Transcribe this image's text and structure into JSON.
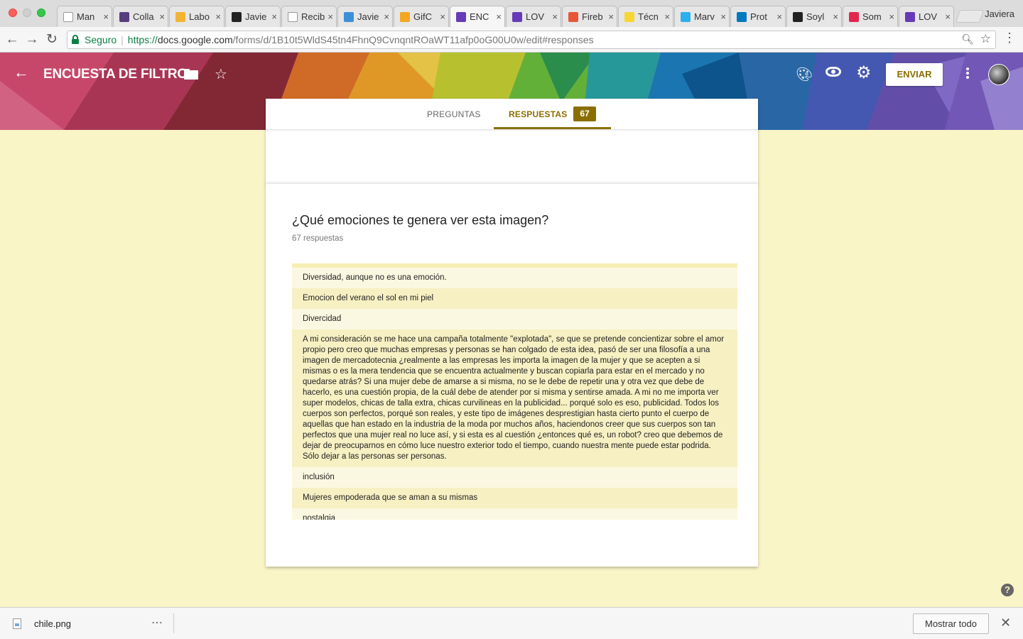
{
  "browser": {
    "tabs": [
      {
        "title": "Man",
        "icon": "document-icon",
        "color": "#ffffff"
      },
      {
        "title": "Colla",
        "icon": "bootstrap-icon",
        "color": "#563d7c"
      },
      {
        "title": "Labo",
        "icon": "code-icon",
        "color": "#f1b434"
      },
      {
        "title": "Javie",
        "icon": "github-icon",
        "color": "#222222"
      },
      {
        "title": "Recib",
        "icon": "gmail-icon",
        "color": "#ffffff"
      },
      {
        "title": "Javie",
        "icon": "filter-icon",
        "color": "#3d8fd8"
      },
      {
        "title": "GifC",
        "icon": "firebase-icon",
        "color": "#f5a623"
      },
      {
        "title": "ENC",
        "icon": "forms-icon",
        "color": "#673ab7",
        "active": true
      },
      {
        "title": "LOV",
        "icon": "forms-icon",
        "color": "#673ab7"
      },
      {
        "title": "Fireb",
        "icon": "firebase-icon",
        "color": "#e8563a"
      },
      {
        "title": "Técn",
        "icon": "code-icon",
        "color": "#f7d634"
      },
      {
        "title": "Marv",
        "icon": "marvel-icon",
        "color": "#2bb0ed"
      },
      {
        "title": "Prot",
        "icon": "trello-icon",
        "color": "#0079bf"
      },
      {
        "title": "Soyl",
        "icon": "github-icon",
        "color": "#222222"
      },
      {
        "title": "Som",
        "icon": "m-icon",
        "color": "#e2264d"
      },
      {
        "title": "LOV",
        "icon": "forms-icon",
        "color": "#673ab7"
      }
    ],
    "tab_close": "×",
    "profile_name": "Javiera",
    "secure_label": "Seguro",
    "url_scheme": "https://",
    "url_host": "docs.google.com",
    "url_path": "/forms/d/1B10t5WldS45tn4FhnQ9CvnqntROaWT11afp0oG00U0w/edit#responses"
  },
  "header": {
    "form_title": "ENCUESTA DE FILTRO",
    "send_label": "ENVIAR"
  },
  "tabs": {
    "questions_label": "PREGUNTAS",
    "responses_label": "RESPUESTAS",
    "responses_count": "67"
  },
  "question": {
    "title": "¿Qué emociones te genera ver esta imagen?",
    "response_total": "67 respuestas",
    "responses": [
      "Diversidad, aunque no es una emoción.",
      "Emocion del verano el sol en mi piel",
      "Divercidad",
      "A mi consideración se me hace una campaña totalmente \"explotada\", se que se pretende concientizar sobre el amor propio pero creo que muchas empresas y personas se han colgado de esta idea, pasó de ser una filosofía a una imagen de mercadotecnia ¿realmente a las empresas les importa la imagen de la mujer y que se acepten a si mismas o es la mera tendencia que se encuentra actualmente y buscan copiarla para estar en el mercado y no quedarse atrás? Si una mujer debe de amarse a si misma, no se le debe de repetir una y otra vez que debe de hacerlo, es una cuestión propia, de la cuál debe de atender por si misma y sentirse amada. A mi no me importa ver super modelos, chicas de talla extra, chicas curvilineas en la publicidad... porqué solo es eso, publicidad. Todos los cuerpos son perfectos, porqué son reales, y este tipo de imágenes desprestigian hasta cierto punto el cuerpo de aquellas que han estado en la industria de la moda por muchos años, haciendonos creer que sus cuerpos son tan perfectos que una mujer real no luce así, y si esta es al cuestión ¿entonces qué es, un robot? creo que debemos de dejar de preocuparnos en cómo luce nuestro exterior todo el tiempo, cuando nuestra mente puede estar podrida. Sólo dejar a las personas ser personas.",
      "inclusión",
      "Mujeres empoderada que se aman a su mismas",
      "nostalgia"
    ]
  },
  "download": {
    "file_name": "chile.png",
    "more_label": "⋯",
    "show_all_label": "Mostrar todo"
  }
}
